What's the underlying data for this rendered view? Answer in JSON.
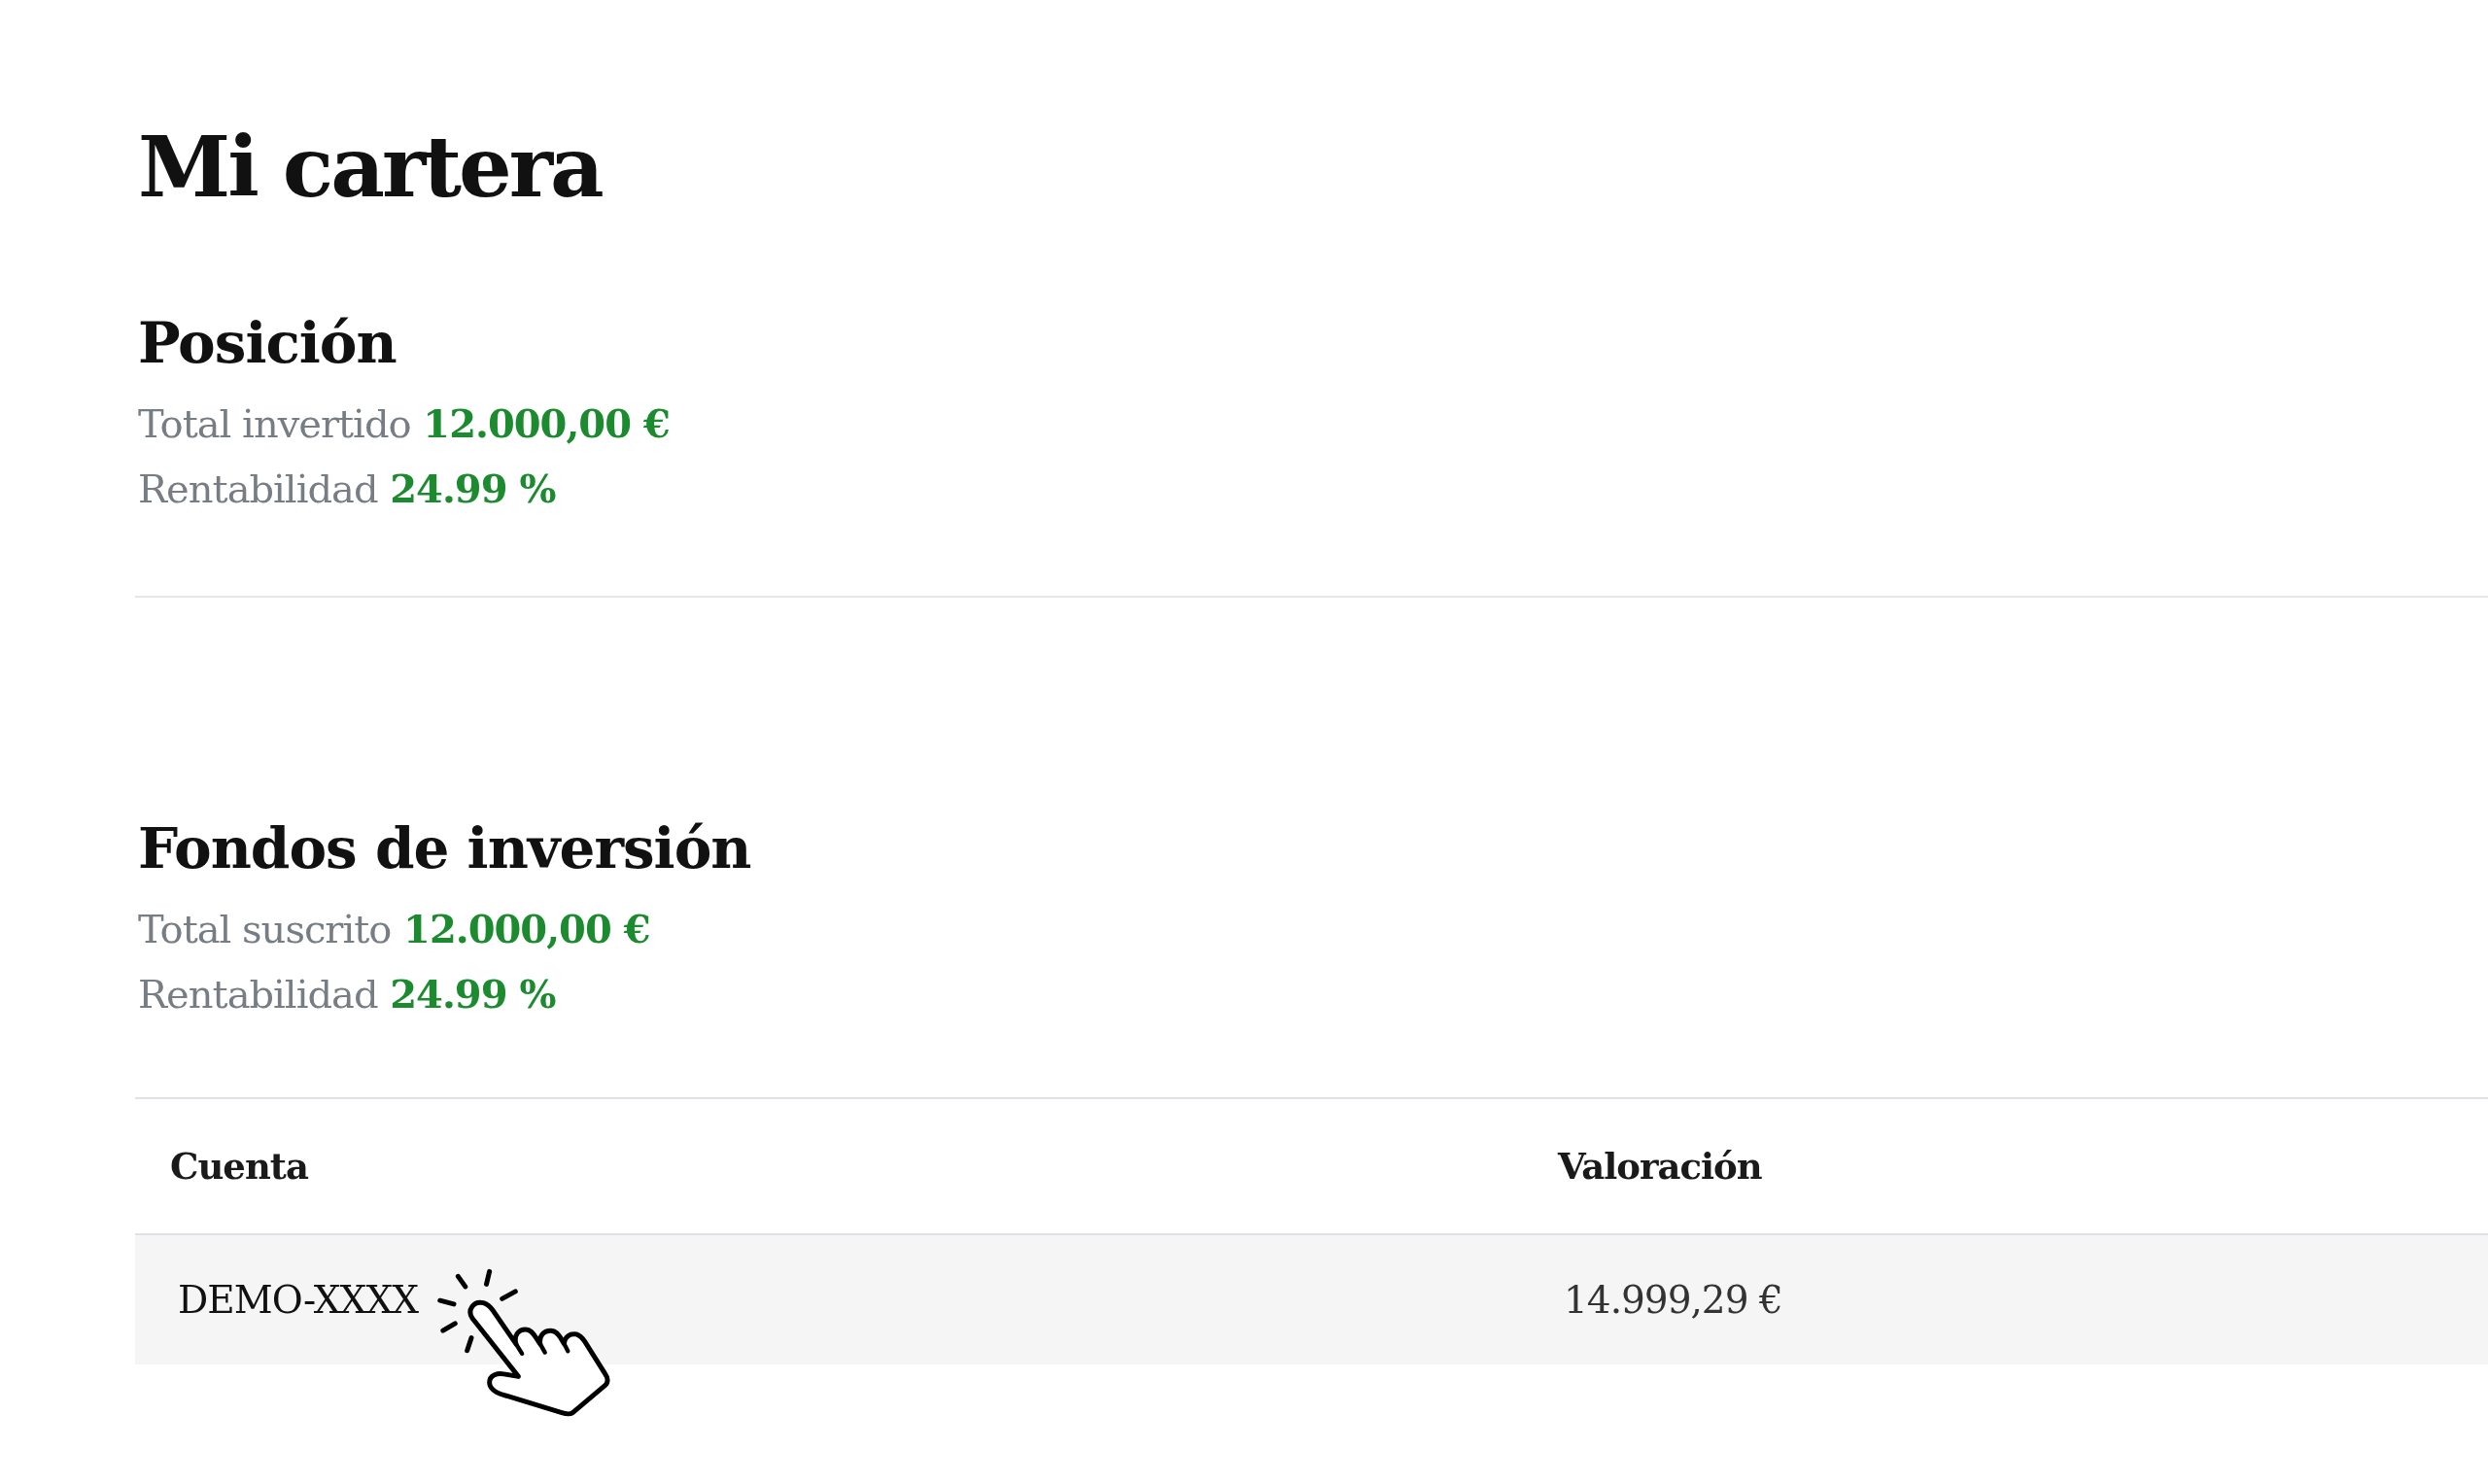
{
  "title": "Mi cartera",
  "sections": [
    {
      "heading": "Posición",
      "stats": [
        {
          "label": "Total invertido",
          "value": "12.000,00 €"
        },
        {
          "label": "Rentabilidad",
          "value": "24.99 %"
        }
      ]
    },
    {
      "heading": "Fondos de inversión",
      "stats": [
        {
          "label": "Total suscrito",
          "value": "12.000,00 €"
        },
        {
          "label": "Rentabilidad",
          "value": "24.99 %"
        }
      ],
      "table": {
        "columns": [
          "Cuenta",
          "Valoración"
        ],
        "rows": [
          [
            "DEMO-XXXX",
            "14.999,29 €"
          ]
        ]
      }
    }
  ]
}
